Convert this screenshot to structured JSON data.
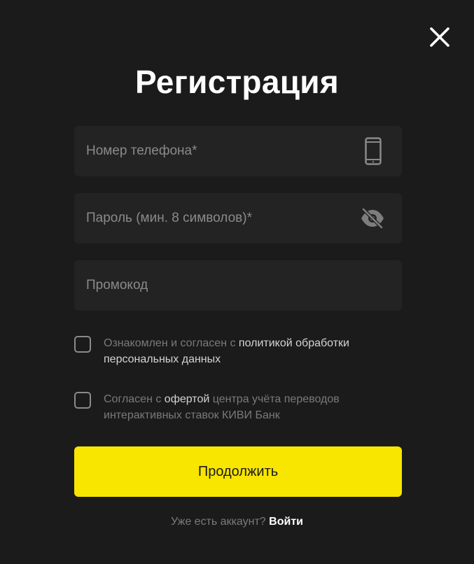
{
  "title": "Регистрация",
  "close": {
    "icon": "close-icon"
  },
  "fields": {
    "phone": {
      "placeholder": "Номер телефона*",
      "value": "",
      "icon": "smartphone-icon"
    },
    "password": {
      "placeholder": "Пароль (мин. 8 символов)*",
      "value": "",
      "icon": "eye-off-icon"
    },
    "promo": {
      "placeholder": "Промокод",
      "value": ""
    }
  },
  "consents": [
    {
      "checked": false,
      "text_before": "Ознакомлен и согласен с ",
      "link": "политикой обработки персональных данных",
      "text_after": ""
    },
    {
      "checked": false,
      "text_before": "Согласен с ",
      "link": "офертой",
      "text_after": " центра учёта переводов интерактивных ставок КИВИ Банк"
    }
  ],
  "submit_label": "Продолжить",
  "login": {
    "prompt": "Уже есть аккаунт?",
    "link": "Войти"
  },
  "colors": {
    "background": "#1b1b1b",
    "field": "#232323",
    "accent": "#f8e500",
    "muted": "#7a7a7a"
  }
}
